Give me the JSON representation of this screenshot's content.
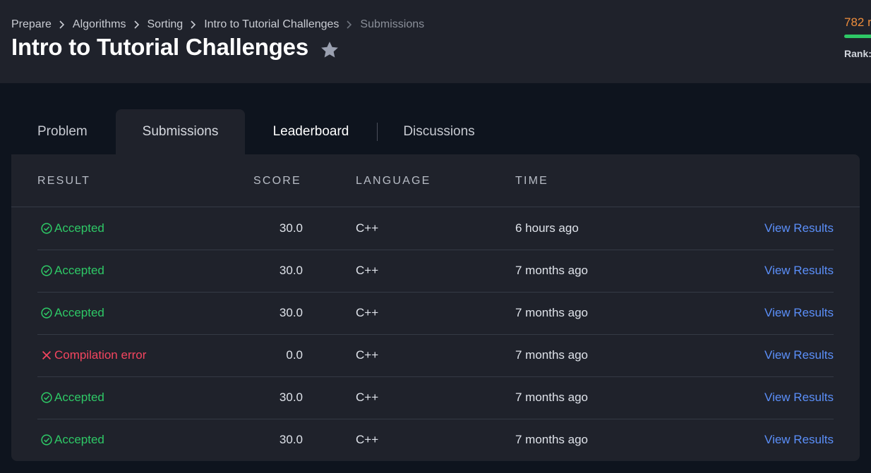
{
  "breadcrumb": {
    "items": [
      "Prepare",
      "Algorithms",
      "Sorting",
      "Intro to Tutorial Challenges"
    ],
    "current": "Submissions"
  },
  "page_title": "Intro to Tutorial Challenges",
  "profile": {
    "score_text": "782 r",
    "rank_text": "Rank:",
    "progress": 1.0
  },
  "tabs": [
    {
      "label": "Problem"
    },
    {
      "label": "Submissions",
      "active": true
    },
    {
      "label": "Leaderboard"
    },
    {
      "label": "Discussions"
    }
  ],
  "table": {
    "headers": {
      "result": "RESULT",
      "score": "SCORE",
      "language": "LANGUAGE",
      "time": "TIME"
    },
    "rows": [
      {
        "result": "Accepted",
        "status": "accepted",
        "score": "30.0",
        "language": "C++",
        "time": "6 hours ago",
        "action": "View Results"
      },
      {
        "result": "Accepted",
        "status": "accepted",
        "score": "30.0",
        "language": "C++",
        "time": "7 months ago",
        "action": "View Results"
      },
      {
        "result": "Accepted",
        "status": "accepted",
        "score": "30.0",
        "language": "C++",
        "time": "7 months ago",
        "action": "View Results"
      },
      {
        "result": "Compilation error",
        "status": "error",
        "score": "0.0",
        "language": "C++",
        "time": "7 months ago",
        "action": "View Results"
      },
      {
        "result": "Accepted",
        "status": "accepted",
        "score": "30.0",
        "language": "C++",
        "time": "7 months ago",
        "action": "View Results"
      },
      {
        "result": "Accepted",
        "status": "accepted",
        "score": "30.0",
        "language": "C++",
        "time": "7 months ago",
        "action": "View Results"
      }
    ]
  },
  "colors": {
    "accepted": "#2ec866",
    "error": "#f4455f",
    "link": "#5b8ff9",
    "score_accent": "#ee8d3c"
  },
  "icons": {
    "breadcrumb_separator": "chevron-right-icon",
    "favorite": "star-icon",
    "accepted": "check-circle-icon",
    "error": "x-icon"
  }
}
